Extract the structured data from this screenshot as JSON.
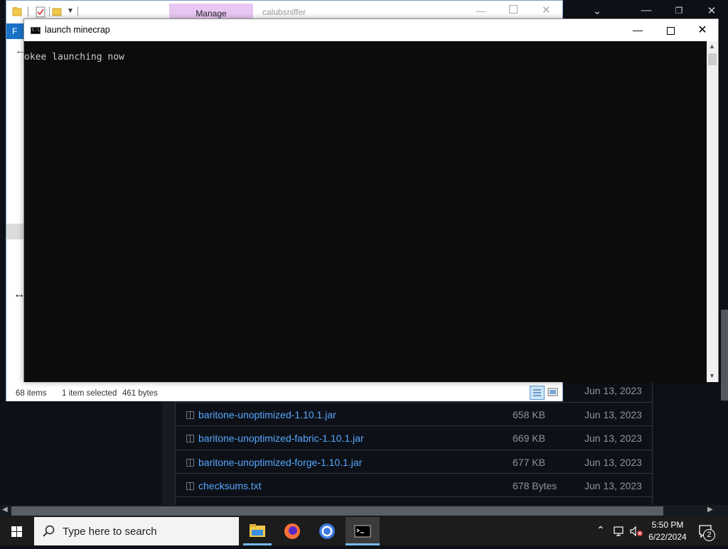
{
  "browser": {
    "files": [
      {
        "name": "baritone-unoptimized-1.10.1.jar",
        "size": "658 KB",
        "date": "Jun 13, 2023"
      },
      {
        "name": "baritone-unoptimized-fabric-1.10.1.jar",
        "size": "669 KB",
        "date": "Jun 13, 2023"
      },
      {
        "name": "baritone-unoptimized-forge-1.10.1.jar",
        "size": "677 KB",
        "date": "Jun 13, 2023"
      },
      {
        "name": "checksums.txt",
        "size": "678 Bytes",
        "date": "Jun 13, 2023"
      }
    ],
    "top_date": "Jun 13, 2023"
  },
  "explorer": {
    "manage_tab": "Manage",
    "folder_name": "calubsniffer",
    "ribbon_file": "F",
    "status": {
      "items": "68 items",
      "selected": "1 item selected",
      "size": "461 bytes"
    }
  },
  "console": {
    "title": "launch minecrap",
    "output": "okee launching now"
  },
  "taskbar": {
    "search_placeholder": "Type here to search",
    "time": "5:50 PM",
    "date": "6/22/2024",
    "notification_count": "2"
  }
}
